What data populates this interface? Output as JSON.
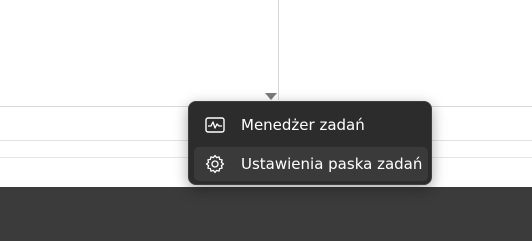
{
  "context_menu": {
    "items": [
      {
        "label": "Menedżer zadań",
        "icon": "task-manager-icon"
      },
      {
        "label": "Ustawienia paska zadań",
        "icon": "gear-icon"
      }
    ]
  },
  "colors": {
    "menu_bg": "#2c2c2c",
    "menu_hover": "#3a3a3a",
    "taskbar_bg": "#3b3b3b",
    "text": "#ffffff"
  }
}
